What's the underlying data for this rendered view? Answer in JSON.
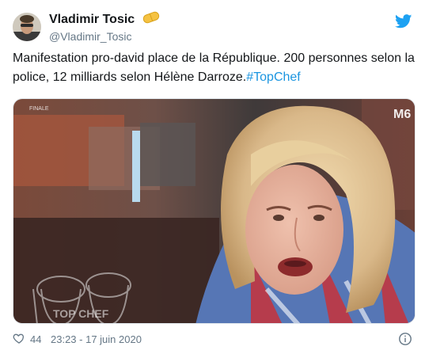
{
  "author": {
    "display_name": "Vladimir Tosic",
    "handle": "@Vladimir_Tosic",
    "emoji": "pill-emoji"
  },
  "tweet": {
    "text": "Manifestation pro-david place de la République. 200 personnes selon la police, 12 milliards selon Hélène Darroze.",
    "hashtag": "#TopChef"
  },
  "media": {
    "overlay_top_left": "FINALE",
    "channel_logo": "M6",
    "watermark": "TOP CHEF"
  },
  "footer": {
    "likes": "44",
    "timestamp": "23:23 - 17 juin 2020"
  },
  "colors": {
    "link": "#1b95e0",
    "twitter_blue": "#1da1f2",
    "secondary_text": "#657786"
  },
  "icons": [
    "twitter-bird-icon",
    "heart-icon",
    "info-icon",
    "pill-emoji"
  ]
}
